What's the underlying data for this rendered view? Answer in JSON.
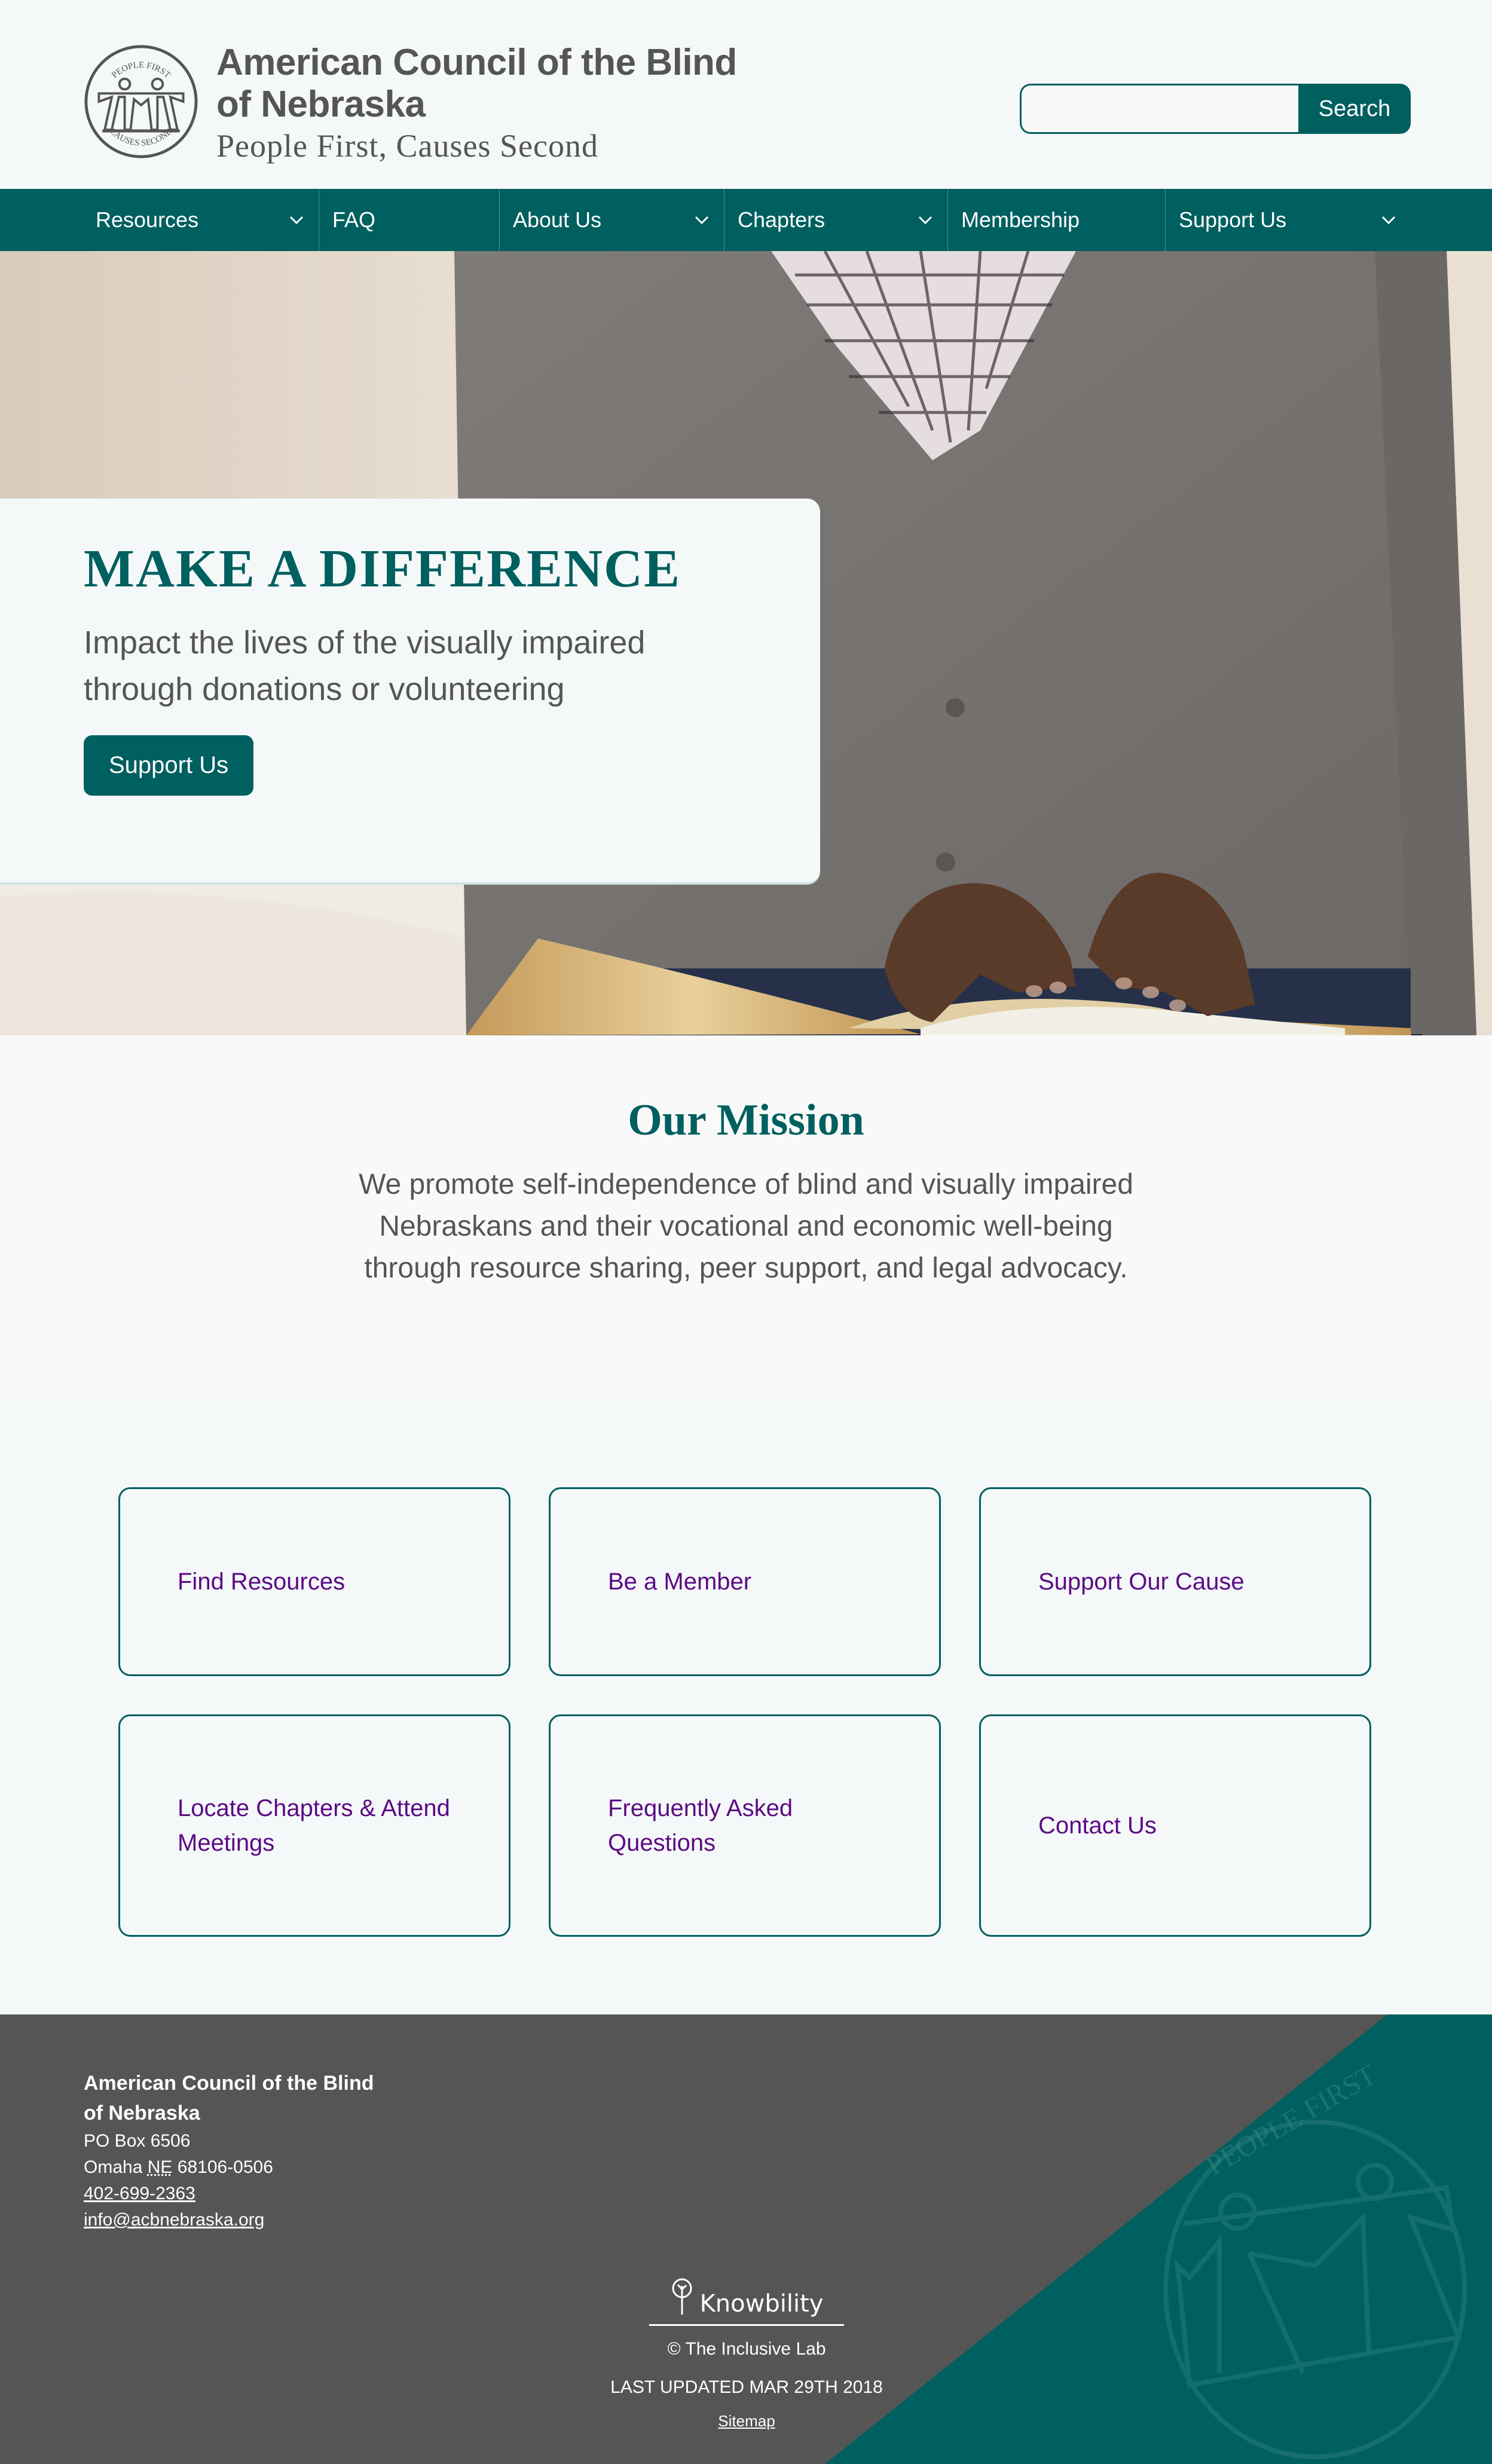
{
  "header": {
    "org_name_line1": "American Council of the Blind",
    "org_name_line2": "of Nebraska",
    "tagline": "People First, Causes Second",
    "seal_top_text": "PEOPLE FIRST",
    "seal_bottom_text": "CAUSES SECOND",
    "search": {
      "value": "",
      "placeholder": "",
      "button_label": "Search"
    }
  },
  "nav": {
    "items": [
      {
        "label": "Resources",
        "has_dropdown": true,
        "icon": "chevron-down-icon"
      },
      {
        "label": "FAQ",
        "has_dropdown": false
      },
      {
        "label": "About Us",
        "has_dropdown": true,
        "icon": "chevron-down-icon"
      },
      {
        "label": "Chapters",
        "has_dropdown": true,
        "icon": "chevron-down-icon"
      },
      {
        "label": "Membership",
        "has_dropdown": false
      },
      {
        "label": "Support Us",
        "has_dropdown": true,
        "icon": "chevron-down-icon"
      }
    ]
  },
  "hero": {
    "title": "MAKE A DIFFERENCE",
    "text": "Impact the lives of the visually impaired through donations or volunteering",
    "button_label": "Support Us",
    "image_alt": "Person reading a braille book on their lap"
  },
  "mission": {
    "title": "Our Mission",
    "text": "We promote self-independence of blind and visually impaired Nebraskans and their vocational and economic well-being through resource sharing, peer support, and legal advocacy."
  },
  "cards": [
    {
      "label": "Find Resources"
    },
    {
      "label": "Be a Member"
    },
    {
      "label": "Support Our Cause"
    },
    {
      "label": "Locate Chapters & Attend Meetings"
    },
    {
      "label": "Frequently Asked Questions"
    },
    {
      "label": "Contact Us"
    }
  ],
  "footer": {
    "org_line1": "American Council of the Blind",
    "org_line2": "of Nebraska",
    "po_box": "PO Box 6506",
    "city": "Omaha",
    "state": "NE",
    "zip": "68106-0506",
    "phone": "402-699-2363",
    "email": "info@acbnebraska.org",
    "partner_logo": "Knowbility",
    "copyright": "© The Inclusive Lab",
    "last_updated": "LAST UPDATED MAR 29TH 2018",
    "sitemap_label": "Sitemap"
  },
  "colors": {
    "primary_teal": "#005f5f",
    "text_gray": "#555555",
    "link_purple": "#5c0a84",
    "background": "#f4f8f9",
    "footer_gray": "#555555"
  }
}
